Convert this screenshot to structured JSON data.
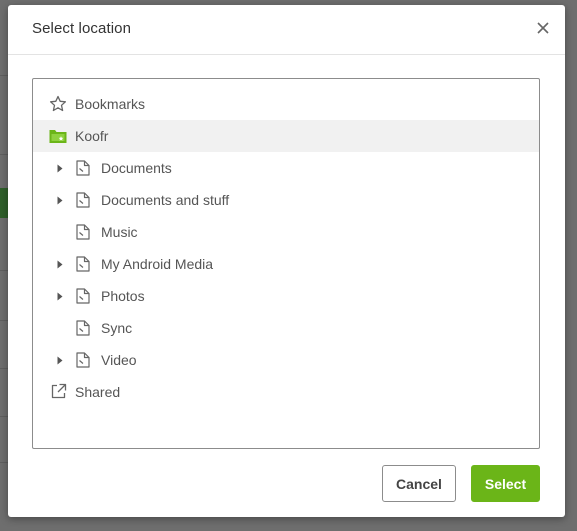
{
  "dialog": {
    "title": "Select location",
    "close_icon": "close-icon"
  },
  "tree": {
    "bookmarks": {
      "label": "Bookmarks",
      "icon": "star-icon"
    },
    "root": {
      "label": "Koofr",
      "icon": "koofr-drive-icon",
      "selected": true
    },
    "folders": [
      {
        "label": "Documents",
        "expandable": true
      },
      {
        "label": "Documents and stuff",
        "expandable": true
      },
      {
        "label": "Music",
        "expandable": false
      },
      {
        "label": "My Android Media",
        "expandable": true
      },
      {
        "label": "Photos",
        "expandable": true
      },
      {
        "label": "Sync",
        "expandable": false
      },
      {
        "label": "Video",
        "expandable": true
      }
    ],
    "shared": {
      "label": "Shared",
      "icon": "external-link-icon"
    }
  },
  "buttons": {
    "cancel": "Cancel",
    "select": "Select"
  },
  "colors": {
    "accent": "#6bb518",
    "text": "#555555",
    "icon": "#666666"
  }
}
